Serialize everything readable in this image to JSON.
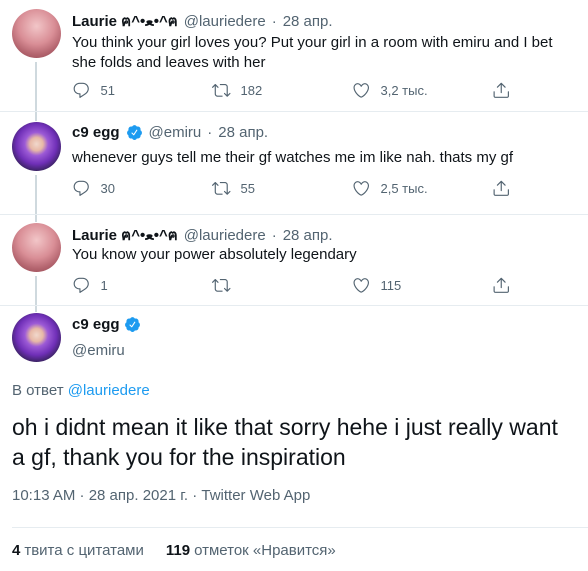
{
  "tweets": [
    {
      "name": "Laurie ฅ^•ﻌ•^ฅ",
      "handle": "@lauriedere",
      "dot": "·",
      "date": "28 апр.",
      "text": "You think your girl loves you? Put your girl in a room with emiru and I bet she folds and leaves with her",
      "replies": "51",
      "retweets": "182",
      "likes": "3,2 тыс."
    },
    {
      "name": "c9 egg",
      "handle": "@emiru",
      "dot": "·",
      "date": "28 апр.",
      "text": "whenever guys tell me their gf watches me im like nah. thats my gf",
      "replies": "30",
      "retweets": "55",
      "likes": "2,5 тыс."
    },
    {
      "name": "Laurie ฅ^•ﻌ•^ฅ",
      "handle": "@lauriedere",
      "dot": "·",
      "date": "28 апр.",
      "text": "You know your power absolutely legendary",
      "replies": "1",
      "retweets": "",
      "likes": "115"
    }
  ],
  "main": {
    "name": "c9 egg",
    "handle": "@emiru",
    "reply_prefix": "В ответ",
    "reply_to": "@lauriedere",
    "text": "oh i didnt mean it like that sorry hehe i just really want a gf, thank you for the inspiration",
    "meta": "10:13 AM · 28 апр. 2021 г. · Twitter Web App",
    "quote_count": "4",
    "quote_label": "твита с цитатами",
    "like_count": "119",
    "like_label": "отметок «Нравится»"
  },
  "colors": {
    "accent": "#1d9bf0",
    "secondary_text": "#536471",
    "border": "#e6ecf0"
  },
  "icons": [
    "reply-icon",
    "retweet-icon",
    "like-icon",
    "share-icon",
    "verified-badge-icon"
  ]
}
